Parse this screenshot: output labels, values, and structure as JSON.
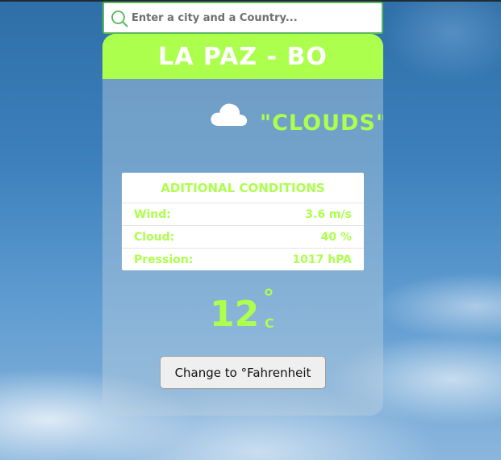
{
  "search": {
    "placeholder": "Enter a city and a Country...",
    "value": "",
    "icon": "search-icon"
  },
  "location": {
    "title": "LA PAZ - BO"
  },
  "weather": {
    "icon": "cloud-icon",
    "description": "\"CLOUDS\""
  },
  "conditions": {
    "title": "ADITIONAL CONDITIONS",
    "rows": [
      {
        "label": "Wind:",
        "value": "3.6 m/s"
      },
      {
        "label": "Cloud:",
        "value": "40 %"
      },
      {
        "label": "Pression:",
        "value": "1017 hPA"
      }
    ]
  },
  "temperature": {
    "value": "12",
    "degree": "°",
    "unit": "C"
  },
  "actions": {
    "change_unit_label": "Change to °Fahrenheit"
  },
  "colors": {
    "accent": "#adff4d",
    "header_bg": "#adff4d",
    "search_border": "#58b85d"
  }
}
